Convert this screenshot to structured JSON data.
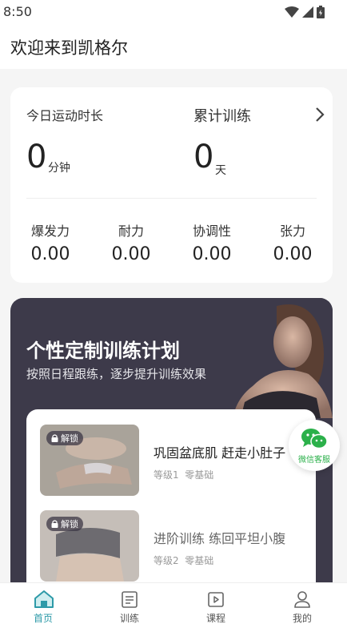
{
  "status_bar": {
    "time": "8:50"
  },
  "header": {
    "title": "欢迎来到凯格尔"
  },
  "stats": {
    "today_label": "今日运动时长",
    "today_value": "0",
    "today_unit": "分钟",
    "total_label": "累计训练",
    "total_value": "0",
    "total_unit": "天",
    "metrics": [
      {
        "label": "爆发力",
        "value": "0.00"
      },
      {
        "label": "耐力",
        "value": "0.00"
      },
      {
        "label": "协调性",
        "value": "0.00"
      },
      {
        "label": "张力",
        "value": "0.00"
      }
    ]
  },
  "plan": {
    "title": "个性定制训练计划",
    "subtitle": "按照日程跟练，逐步提升训练效果",
    "items": [
      {
        "badge": "解锁",
        "name": "巩固盆底肌 赶走小肚子",
        "level": "等级1",
        "tag": "零基础"
      },
      {
        "badge": "解锁",
        "name": "进阶训练 练回平坦小腹",
        "level": "等级2",
        "tag": "零基础"
      }
    ]
  },
  "wechat": {
    "label": "微信客服"
  },
  "tabbar": {
    "active_color": "#2d9aa8",
    "tabs": [
      {
        "label": "首页",
        "icon": "home-icon",
        "active": true
      },
      {
        "label": "训练",
        "icon": "training-list-icon",
        "active": false
      },
      {
        "label": "课程",
        "icon": "video-course-icon",
        "active": false
      },
      {
        "label": "我的",
        "icon": "profile-icon",
        "active": false
      }
    ]
  }
}
